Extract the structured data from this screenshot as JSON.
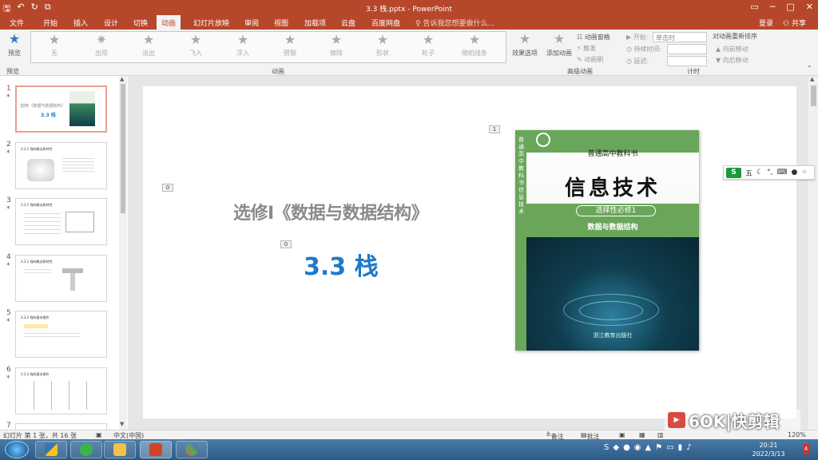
{
  "window": {
    "qat_icons": [
      "save-icon",
      "undo-icon",
      "redo-icon",
      "slideshow-icon"
    ],
    "title": "3.3 栈.pptx - PowerPoint",
    "controls": [
      "restore-icon",
      "minimize-icon",
      "maximize-icon",
      "close-icon"
    ]
  },
  "tabs": [
    "文件",
    "开始",
    "插入",
    "设计",
    "切换",
    "动画",
    "幻灯片放映",
    "审阅",
    "视图",
    "加载项",
    "云盘",
    "百度网盘"
  ],
  "active_tab": "动画",
  "tell_me": "告诉我您想要做什么...",
  "login": "登录",
  "share": "共享",
  "ribbon": {
    "preview_label": "预览",
    "preview_group": "预览",
    "animation_group": "动画",
    "animations": [
      "无",
      "出现",
      "淡出",
      "飞入",
      "浮入",
      "劈裂",
      "擦除",
      "形状",
      "轮子",
      "随机线条"
    ],
    "effect_options": "效果选项",
    "add_animation": "添加动画",
    "animation_pane": "动画窗格",
    "trigger": "触发",
    "animation_painter": "动画刷",
    "advanced_group": "高级动画",
    "start_label": "开始:",
    "start_value": "单击时",
    "duration_label": "持续时间:",
    "delay_label": "延迟:",
    "timing_group": "计时",
    "reorder_label": "对动画重新排序",
    "move_earlier": "向前移动",
    "move_later": "向后移动"
  },
  "thumbnails": [
    {
      "num": "1",
      "title": "3.3 栈",
      "subtitle": "选修I《数据与数据结构》"
    },
    {
      "num": "2",
      "title": "3.3.1 栈的概念和特性"
    },
    {
      "num": "3",
      "title": "3.3.1 栈的概念和特性"
    },
    {
      "num": "4",
      "title": "3.3.1 栈的概念和特性"
    },
    {
      "num": "5",
      "title": "3.3.2 栈的基本操作"
    },
    {
      "num": "6",
      "title": "3.3.2 栈的基本操作"
    },
    {
      "num": "7"
    }
  ],
  "slide": {
    "subtitle": "选修I《数据与数据结构》",
    "title": "3.3 栈",
    "anim_tags": [
      "0",
      "0",
      "1"
    ],
    "book": {
      "series": "普通高中教科书",
      "title": "信息技术",
      "elective": "选择性必修1",
      "subtitle": "数据与数据结构",
      "spine": "普通高中教科书 信息技术",
      "publisher": "浙江教育出版社"
    }
  },
  "ime": {
    "logo": "S",
    "mode": "五",
    "icons": [
      "moon-icon",
      "punctuation-icon",
      "keyboard-icon",
      "user-icon",
      "grid-icon"
    ]
  },
  "status": {
    "slide_info": "幻灯片 第 1 张，共 16 张",
    "language": "中文(中国)",
    "notes": "备注",
    "comments": "批注",
    "zoom": "120%"
  },
  "watermark": "6OK|快剪辑",
  "taskbar": {
    "time": "20:21",
    "date": "2022/3/13",
    "notify_count": "4"
  },
  "colors": {
    "accent": "#b7472a",
    "title_blue": "#1f7ac8",
    "subtitle_gray": "#8a8a8a",
    "book_green": "#6aa65a"
  }
}
